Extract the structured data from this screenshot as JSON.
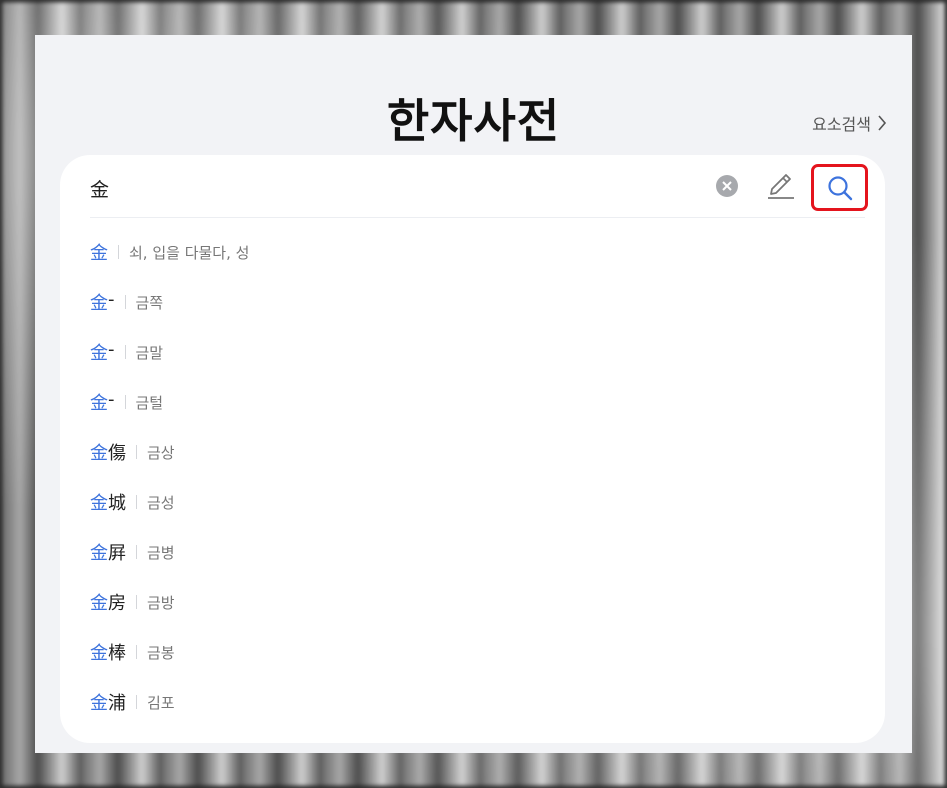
{
  "title": "한자사전",
  "element_search_label": "요소검색",
  "search": {
    "value": "金"
  },
  "colors": {
    "highlight": "#3d73dd",
    "search_outline": "#e4141d"
  },
  "icons": {
    "clear": "clear-icon",
    "pen": "pen-icon",
    "search": "search-icon",
    "chevron": "chevron-right-icon"
  },
  "suggestions": [
    {
      "hl": "金",
      "rest": "",
      "meaning": "쇠, 입을 다물다, 성"
    },
    {
      "hl": "金",
      "rest": "-",
      "meaning": "금쪽"
    },
    {
      "hl": "金",
      "rest": "-",
      "meaning": "금말"
    },
    {
      "hl": "金",
      "rest": "-",
      "meaning": "금털"
    },
    {
      "hl": "金",
      "rest": "傷",
      "meaning": "금상"
    },
    {
      "hl": "金",
      "rest": "城",
      "meaning": "금성"
    },
    {
      "hl": "金",
      "rest": "屛",
      "meaning": "금병"
    },
    {
      "hl": "金",
      "rest": "房",
      "meaning": "금방"
    },
    {
      "hl": "金",
      "rest": "棒",
      "meaning": "금봉"
    },
    {
      "hl": "金",
      "rest": "浦",
      "meaning": "김포"
    }
  ]
}
